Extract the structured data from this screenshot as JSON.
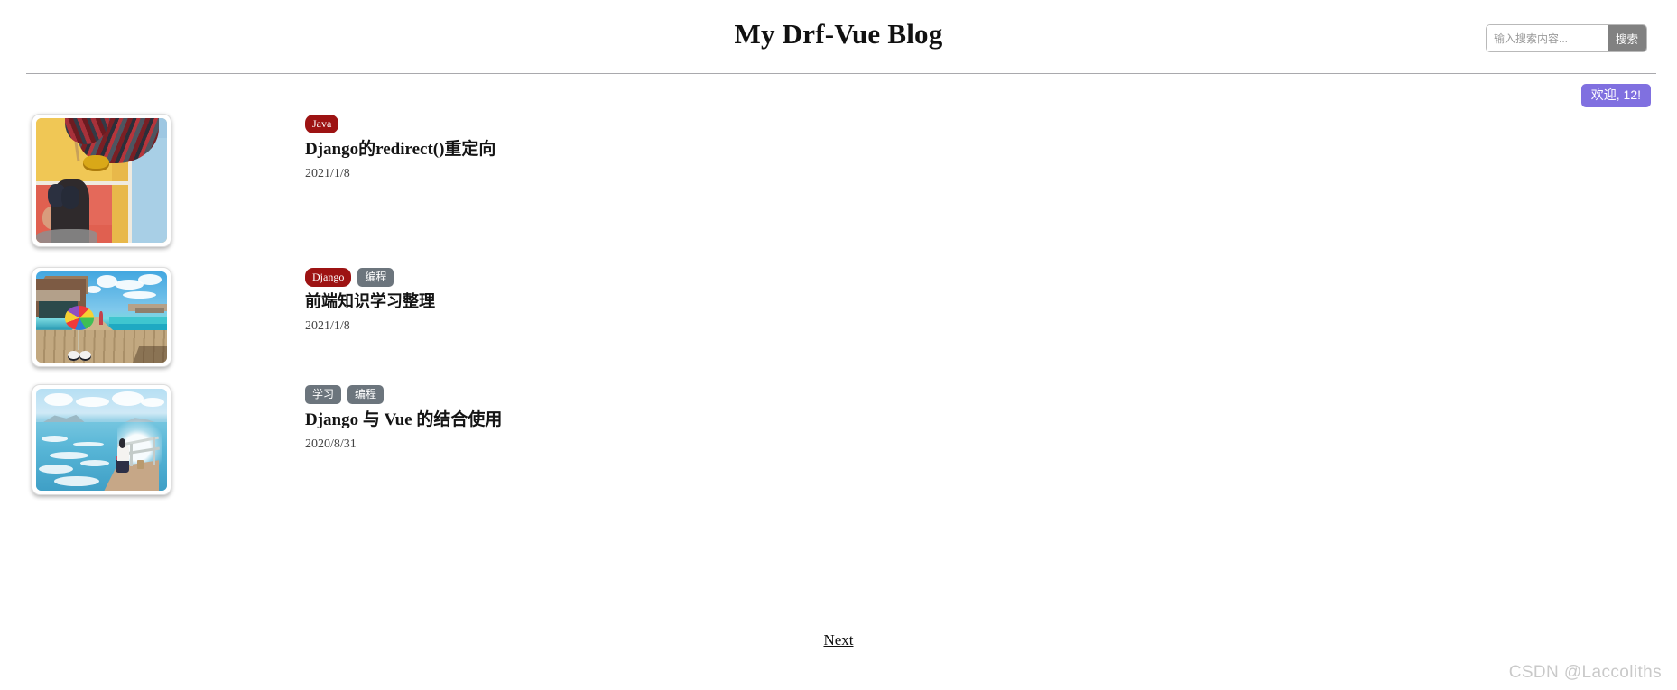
{
  "header": {
    "site_title": "My Drf-Vue Blog",
    "search": {
      "placeholder": "输入搜索内容...",
      "value": "",
      "button_label": "搜索"
    }
  },
  "user": {
    "welcome_label": "欢迎, 12!"
  },
  "posts": [
    {
      "tags": [
        {
          "label": "Java",
          "style": "danger"
        }
      ],
      "title": "Django的redirect()重定向",
      "date": "2021/1/8",
      "thumbnail_alt": "colorful-pavement-photo"
    },
    {
      "tags": [
        {
          "label": "Django",
          "style": "danger"
        },
        {
          "label": "编程",
          "style": "secondary"
        }
      ],
      "title": "前端知识学习整理",
      "date": "2021/1/8",
      "thumbnail_alt": "tropical-pier-pinwheel-photo"
    },
    {
      "tags": [
        {
          "label": "学习",
          "style": "secondary"
        },
        {
          "label": "编程",
          "style": "secondary"
        }
      ],
      "title": "Django 与 Vue 的结合使用",
      "date": "2020/8/31",
      "thumbnail_alt": "seaside-jetty-photo"
    }
  ],
  "pagination": {
    "next_label": "Next"
  },
  "watermark": {
    "text": "CSDN @Laccoliths"
  },
  "colors": {
    "tag_danger": "#9d1313",
    "tag_secondary": "#6c757d",
    "welcome_badge": "#8070e0",
    "search_button": "#818181",
    "rule": "#a9a9ad",
    "watermark": "#c9c9c9"
  }
}
